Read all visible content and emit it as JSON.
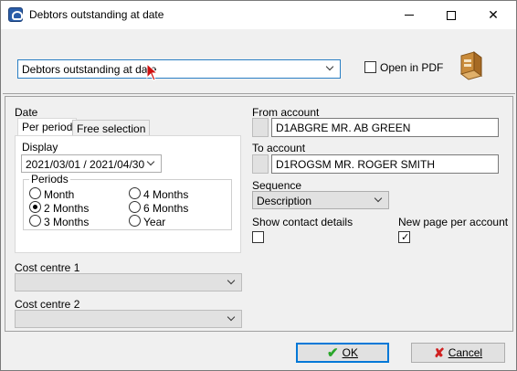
{
  "window": {
    "title": "Debtors outstanding at date"
  },
  "report": {
    "selected": "Debtors outstanding at date",
    "open_in_pdf_label": "Open in PDF",
    "open_in_pdf_checked": false
  },
  "date": {
    "label": "Date",
    "tabs": [
      {
        "label": "Per period",
        "active": true
      },
      {
        "label": "Free selection",
        "active": false
      }
    ],
    "display_label": "Display",
    "display_value": "2021/03/01 / 2021/04/30",
    "periods_label": "Periods",
    "periods": [
      {
        "label": "Month",
        "checked": false
      },
      {
        "label": "4 Months",
        "checked": false
      },
      {
        "label": "2 Months",
        "checked": true
      },
      {
        "label": "6 Months",
        "checked": false
      },
      {
        "label": "3 Months",
        "checked": false
      },
      {
        "label": "Year",
        "checked": false
      }
    ]
  },
  "cost_centre_1": {
    "label": "Cost centre 1",
    "value": ""
  },
  "cost_centre_2": {
    "label": "Cost centre 2",
    "value": ""
  },
  "from_account": {
    "label": "From account",
    "value": "D1ABGRE MR. AB GREEN"
  },
  "to_account": {
    "label": "To account",
    "value": "D1ROGSM MR. ROGER SMITH"
  },
  "sequence": {
    "label": "Sequence",
    "value": "Description"
  },
  "show_contact_details": {
    "label": "Show contact details",
    "checked": false
  },
  "new_page_per_account": {
    "label": "New page per account",
    "checked": true
  },
  "buttons": {
    "ok": "OK",
    "cancel": "Cancel"
  },
  "colors": {
    "accent": "#0078d7",
    "ok_icon": "#2aa62a",
    "cancel_icon": "#d02020",
    "cursor": "#d01010"
  }
}
